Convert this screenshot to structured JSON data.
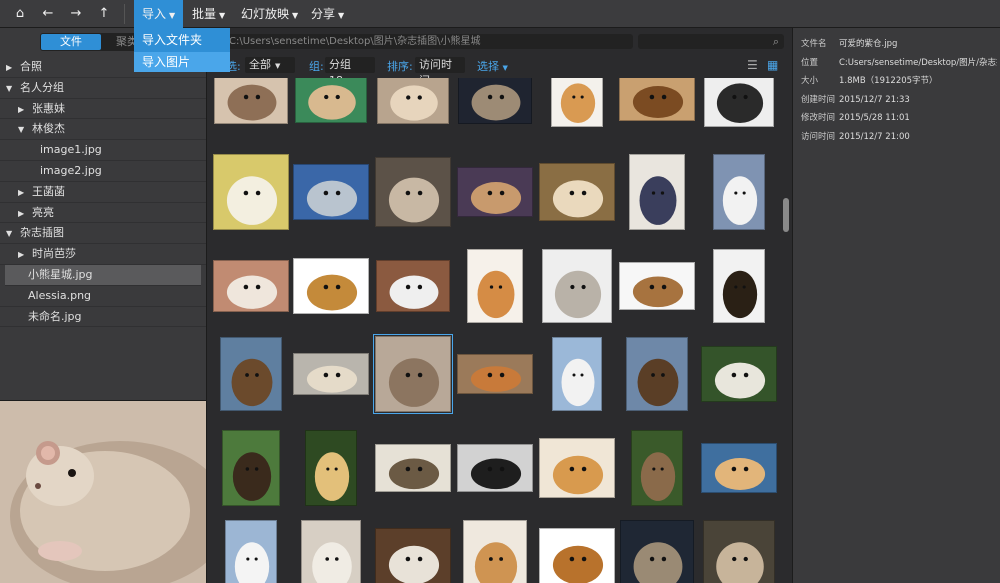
{
  "toolbar": {
    "home_icon": "⌂",
    "back_icon": "←",
    "forward_icon": "→",
    "up_icon": "↑",
    "menus": [
      {
        "label": "导入"
      },
      {
        "label": "批量"
      },
      {
        "label": "幻灯放映"
      },
      {
        "label": "分享"
      }
    ],
    "import_dropdown": [
      "导入文件夹",
      "导入图片"
    ]
  },
  "left_panel": {
    "tabs": {
      "active": "文件",
      "inactive": "聚类"
    },
    "tree": [
      {
        "label": "合照",
        "twist": "▶"
      },
      {
        "label": "名人分组",
        "twist": "▼"
      },
      {
        "label": "张惠妹",
        "twist": "▶"
      },
      {
        "label": "林俊杰",
        "twist": "▼"
      },
      {
        "label": "image1.jpg",
        "twist": ""
      },
      {
        "label": "image2.jpg",
        "twist": ""
      },
      {
        "label": "王菡菡",
        "twist": "▶"
      },
      {
        "label": "亮亮",
        "twist": "▶"
      },
      {
        "label": "杂志插图",
        "twist": "▼"
      },
      {
        "label": "时尚芭莎",
        "twist": "▶"
      },
      {
        "label": "小熊星城.jpg",
        "twist": ""
      },
      {
        "label": "Alessia.png",
        "twist": ""
      },
      {
        "label": "未命名.jpg",
        "twist": ""
      }
    ]
  },
  "center": {
    "path": "C:\\Users\\sensetime\\Desktop\\图片\\杂志插图\\小熊星城",
    "search_placeholder": "",
    "filter": {
      "label_a": "筛选:",
      "value_a": "全部",
      "label_group": "组:",
      "value_group": "分组18",
      "label_sort": "排序:",
      "value_sort": "访问时间",
      "select_label": "选择"
    }
  },
  "details": {
    "rows": [
      {
        "k": "文件名",
        "v": "可爱的紫仓.jpg"
      },
      {
        "k": "位置",
        "v": "C:Users/sensetime/Desktop/图片/杂志插..."
      },
      {
        "k": "大小",
        "v": "1.8MB（1912205字节）"
      },
      {
        "k": "创建时间",
        "v": "2015/12/7 21:33"
      },
      {
        "k": "修改时间",
        "v": "2015/5/28 11:01"
      },
      {
        "k": "访问时间",
        "v": "2015/12/7 21:00"
      }
    ]
  },
  "colors": {
    "accent": "#2f8fd6",
    "accent_text": "#4aa6ea",
    "panel": "#3a3a3c",
    "canvas": "#2b2b2d"
  },
  "thumbnails": [
    {
      "name": "hamster",
      "bg": "#d6c3ae",
      "fg": "#8e6f56",
      "selected": false
    },
    {
      "name": "hamster",
      "bg": "#3b8a5a",
      "fg": "#d8b98f",
      "selected": false
    },
    {
      "name": "hamster",
      "bg": "#b8a48e",
      "fg": "#e7d5bd",
      "selected": false
    },
    {
      "name": "mouse",
      "bg": "#1f2430",
      "fg": "#9d8b75",
      "selected": false
    },
    {
      "name": "cat",
      "bg": "#f4f1ec",
      "fg": "#d99a52",
      "selected": false
    },
    {
      "name": "dog",
      "bg": "#c9a070",
      "fg": "#7b4b22",
      "selected": false
    },
    {
      "name": "bulldog",
      "bg": "#eeeeee",
      "fg": "#2a2a2a",
      "selected": false
    },
    {
      "name": "cat",
      "bg": "#d8c96b",
      "fg": "#f3efe0",
      "selected": false
    },
    {
      "name": "hamsters",
      "bg": "#3a67a8",
      "fg": "#b9c4cf",
      "selected": false
    },
    {
      "name": "cat",
      "bg": "#5c5248",
      "fg": "#c8b8a4",
      "selected": false
    },
    {
      "name": "hamster",
      "bg": "#4a3a55",
      "fg": "#c89a6d",
      "selected": false
    },
    {
      "name": "hamster",
      "bg": "#8a6e44",
      "fg": "#ead9bd",
      "selected": false
    },
    {
      "name": "dog-cat",
      "bg": "#e9e5de",
      "fg": "#3a3e5c",
      "selected": false
    },
    {
      "name": "bull-terrier",
      "bg": "#7f93b2",
      "fg": "#f2f2f2",
      "selected": false
    },
    {
      "name": "beagle",
      "bg": "#c18b72",
      "fg": "#efe6dc",
      "selected": false
    },
    {
      "name": "puppy",
      "bg": "#ffffff",
      "fg": "#c48a3a",
      "selected": false
    },
    {
      "name": "cat",
      "bg": "#8b5a40",
      "fg": "#efefef",
      "selected": false
    },
    {
      "name": "cat",
      "bg": "#f6f1ea",
      "fg": "#d58c45",
      "selected": false
    },
    {
      "name": "cat",
      "bg": "#eeeeee",
      "fg": "#b9b2a8",
      "selected": false
    },
    {
      "name": "beagle",
      "bg": "#f7f7f7",
      "fg": "#a7733f",
      "selected": false
    },
    {
      "name": "dog",
      "bg": "#f2f2f2",
      "fg": "#2a2015",
      "selected": false
    },
    {
      "name": "bear",
      "bg": "#5f7fa0",
      "fg": "#6b4a2c",
      "selected": false
    },
    {
      "name": "cat",
      "bg": "#b9b5ad",
      "fg": "#e5dbc9",
      "selected": false
    },
    {
      "name": "hamster",
      "bg": "#b8a898",
      "fg": "#8c7560",
      "selected": true
    },
    {
      "name": "teddy",
      "bg": "#9b7a5a",
      "fg": "#c87a3a",
      "selected": false
    },
    {
      "name": "polar-bear",
      "bg": "#9bb8d8",
      "fg": "#f2f2f2",
      "selected": false
    },
    {
      "name": "bear",
      "bg": "#6e88a8",
      "fg": "#5a3e26",
      "selected": false
    },
    {
      "name": "polar-bear",
      "bg": "#34542a",
      "fg": "#e8e6dc",
      "selected": false
    },
    {
      "name": "monkey",
      "bg": "#4d7a3c",
      "fg": "#3a2a1c",
      "selected": false
    },
    {
      "name": "monkey",
      "bg": "#2e4a22",
      "fg": "#e3c07a",
      "selected": false
    },
    {
      "name": "monkey",
      "bg": "#e6e1d6",
      "fg": "#6b5a44",
      "selected": false
    },
    {
      "name": "dog",
      "bg": "#d2d2d2",
      "fg": "#1e1e1e",
      "selected": false
    },
    {
      "name": "pomeranian",
      "bg": "#f0e6d6",
      "fg": "#d89a4e",
      "selected": false
    },
    {
      "name": "monkey",
      "bg": "#3a5a2a",
      "fg": "#8a6a4a",
      "selected": false
    },
    {
      "name": "hamster",
      "bg": "#3f6f9f",
      "fg": "#e2b57a",
      "selected": false
    },
    {
      "name": "polar-bear",
      "bg": "#9cb6d4",
      "fg": "#f4f4f4",
      "selected": false
    },
    {
      "name": "dog-cat",
      "bg": "#d7cfc4",
      "fg": "#f0ece4",
      "selected": false
    },
    {
      "name": "hamster",
      "bg": "#5c3f2a",
      "fg": "#e8e2d8",
      "selected": false
    },
    {
      "name": "cat",
      "bg": "#efe8de",
      "fg": "#cf9452",
      "selected": false
    },
    {
      "name": "puppy",
      "bg": "#ffffff",
      "fg": "#b8722c",
      "selected": false
    },
    {
      "name": "mouse",
      "bg": "#1f2734",
      "fg": "#9a8a74",
      "selected": false
    },
    {
      "name": "cat",
      "bg": "#4a4438",
      "fg": "#c7b49a",
      "selected": false
    }
  ]
}
